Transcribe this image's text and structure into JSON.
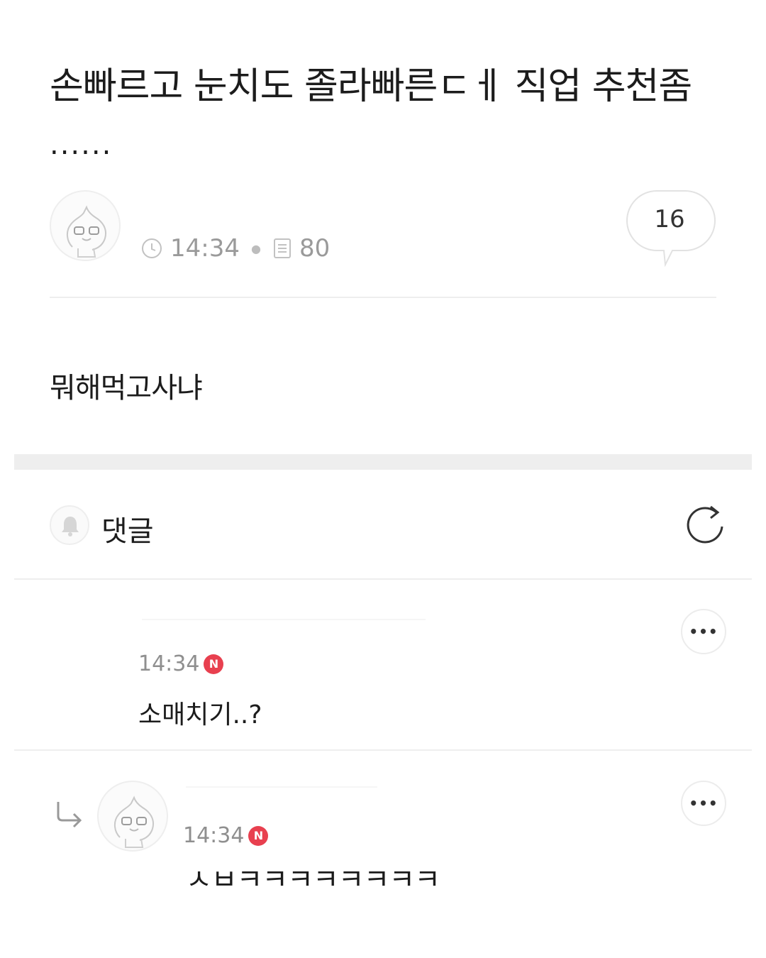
{
  "post": {
    "title": "손빠르고 눈치도 졸라빠른ㄷㅔ 직업 추천좀",
    "title_suffix": "......",
    "time": "14:34",
    "views": "80",
    "comment_count": "16",
    "body": "뭐해먹고사냐"
  },
  "comments_section": {
    "title": "댓글"
  },
  "comments": [
    {
      "time": "14:34",
      "badge": "N",
      "text": "소매치기..?"
    },
    {
      "time": "14:34",
      "badge": "N",
      "text": "ㅅㅂㅋㅋㅋㅋㅋㅋㅋㅋ"
    }
  ],
  "icons": {
    "avatar": "peach-character-avatar",
    "time": "clock-icon",
    "views": "document-icon",
    "comments": "speech-bubble-icon",
    "notify": "bell-icon",
    "refresh": "refresh-icon",
    "more": "more-icon",
    "reply": "reply-arrow-icon"
  },
  "colors": {
    "new_badge": "#e8404f",
    "divider": "#eeeeee",
    "meta_text": "#9a9a9a"
  }
}
